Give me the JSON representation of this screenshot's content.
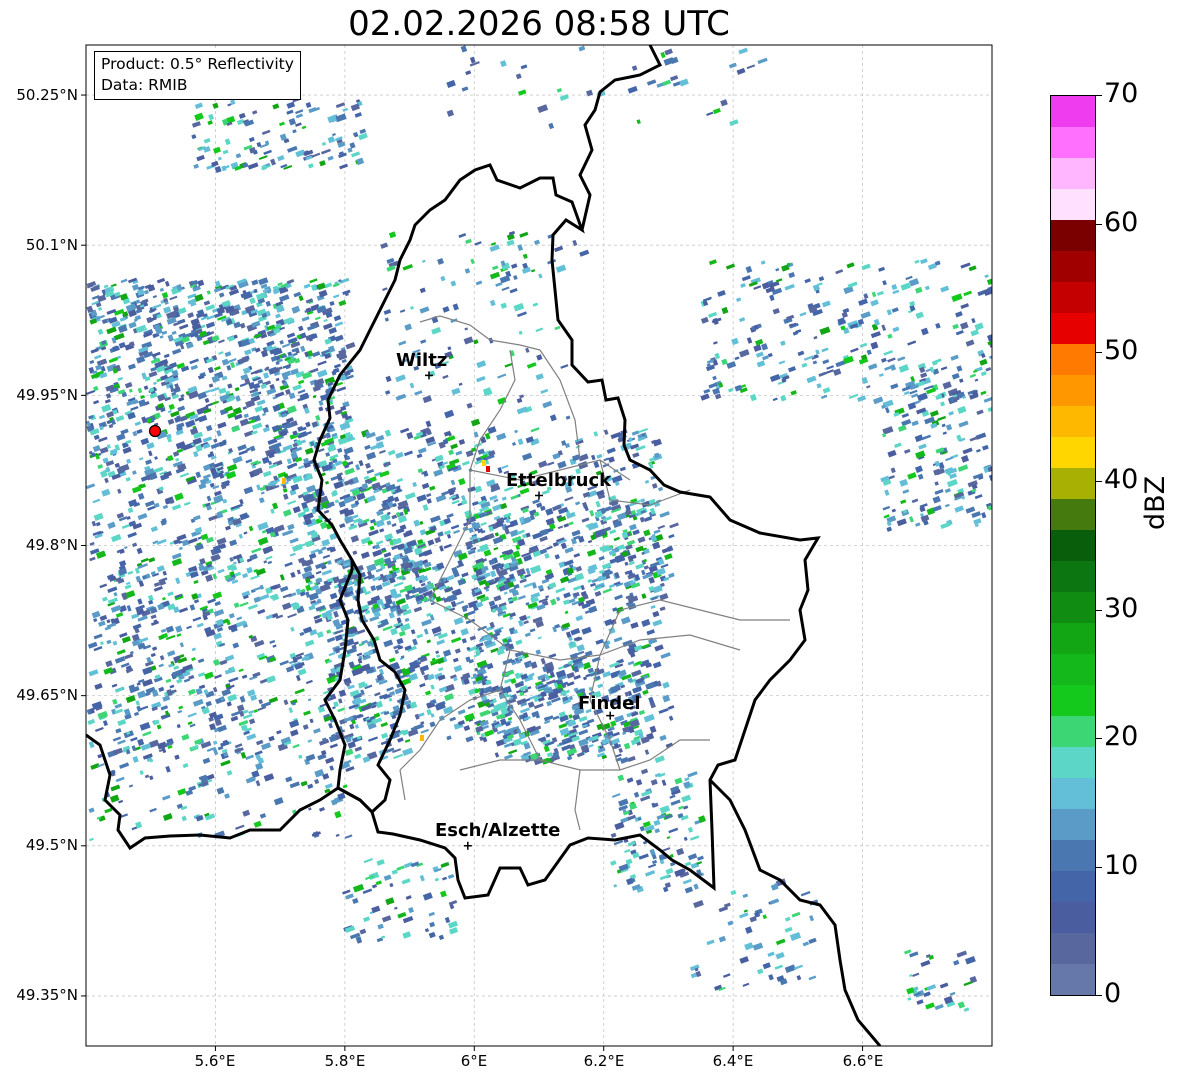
{
  "title": "02.02.2026 08:58 UTC",
  "info": {
    "product": "Product: 0.5° Reflectivity",
    "data": "Data: RMIB"
  },
  "axes": {
    "lat_ticks": [
      "50.25°N",
      "50.1°N",
      "49.95°N",
      "49.8°N",
      "49.65°N",
      "49.5°N",
      "49.35°N"
    ],
    "lon_ticks": [
      "5.6°E",
      "5.8°E",
      "6°E",
      "6.2°E",
      "6.4°E",
      "6.6°E"
    ],
    "lon_range": [
      5.4,
      6.8
    ],
    "lat_range": [
      49.3,
      50.3
    ],
    "grid": true
  },
  "cities": [
    {
      "name": "Wiltz",
      "lon": 5.93,
      "lat": 49.97
    },
    {
      "name": "Ettelbruck",
      "lon": 6.1,
      "lat": 49.85
    },
    {
      "name": "Findel",
      "lon": 6.21,
      "lat": 49.63
    },
    {
      "name": "Esch/Alzette",
      "lon": 5.99,
      "lat": 49.5
    }
  ],
  "radar_site": {
    "lon": 5.505,
    "lat": 49.915,
    "color": "#ff0000"
  },
  "colorbar": {
    "label": "dBZ",
    "ticks": [
      "0",
      "10",
      "20",
      "30",
      "40",
      "50",
      "60",
      "70"
    ],
    "range": [
      0,
      70
    ],
    "colors": [
      "#6677aa",
      "#58689f",
      "#4a5d9e",
      "#4466a8",
      "#4a77b0",
      "#5a9cc7",
      "#63bfd8",
      "#5cd6c6",
      "#3cd674",
      "#14c81c",
      "#14b81a",
      "#12a614",
      "#108c12",
      "#0c7610",
      "#085e0a",
      "#447a0e",
      "#a8b004",
      "#ffd600",
      "#ffb800",
      "#ff9800",
      "#ff7a00",
      "#e60000",
      "#c40000",
      "#a00000",
      "#7a0000",
      "#ffe0ff",
      "#ffb6ff",
      "#ff70ff",
      "#ee3cee"
    ]
  }
}
